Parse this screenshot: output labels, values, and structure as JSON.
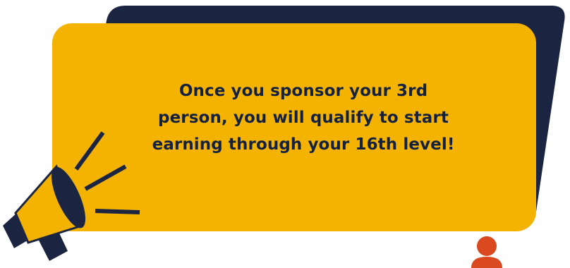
{
  "message": {
    "line1": "Once you sponsor your 3rd",
    "line2": "person, you will qualify to start",
    "line3": "earning through your 16th level!"
  },
  "colors": {
    "bubble": "#f5b301",
    "backdrop": "#1b2541",
    "text": "#14213d",
    "person": "#d9481f",
    "megaphone_dark": "#1b2541",
    "megaphone_light": "#f5b301"
  },
  "icons": {
    "megaphone": "megaphone-icon",
    "person": "person-icon"
  }
}
